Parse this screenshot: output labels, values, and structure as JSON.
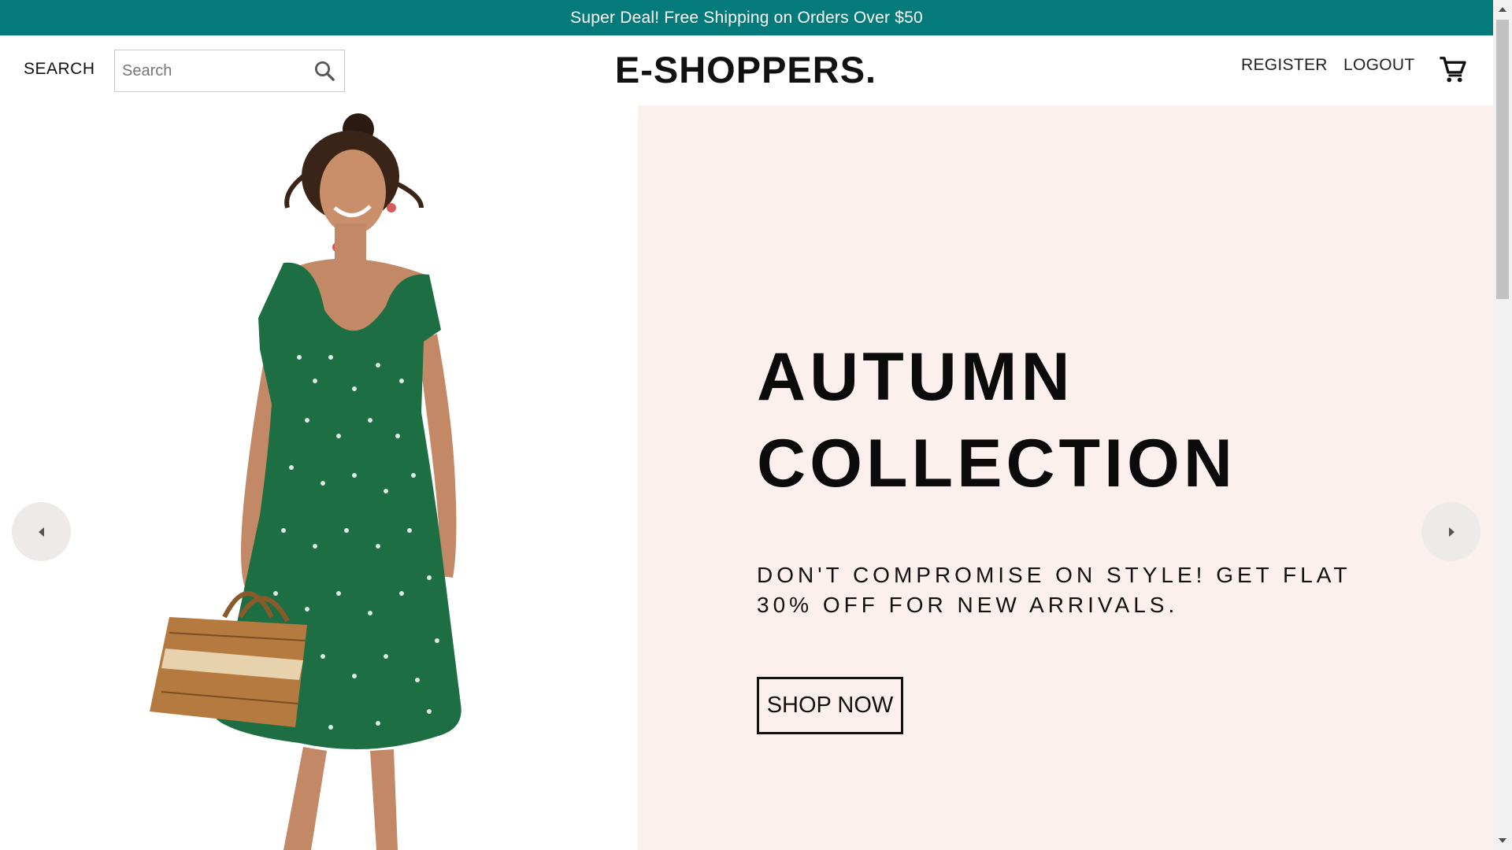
{
  "announcement": {
    "text": "Super Deal! Free Shipping on Orders Over $50",
    "bg_color": "#047b7a"
  },
  "header": {
    "search_label": "SEARCH",
    "search_placeholder": "Search",
    "search_value": "",
    "logo": "E-SHOPPERS.",
    "nav": {
      "register": "REGISTER",
      "logout": "LOGOUT"
    },
    "icons": {
      "search": "search-icon",
      "cart": "cart-icon"
    }
  },
  "slider": {
    "title_line1": "AUTUMN",
    "title_line2": "COLLECTION",
    "description": "DON'T COMPROMISE ON STYLE! GET FLAT 30% OFF FOR NEW ARRIVALS.",
    "button_label": "SHOP NOW",
    "info_bg_color": "#fbf0ee",
    "image": "woman-green-dress-with-basket",
    "icons": {
      "prev": "arrow-left-icon",
      "next": "arrow-right-icon"
    }
  }
}
